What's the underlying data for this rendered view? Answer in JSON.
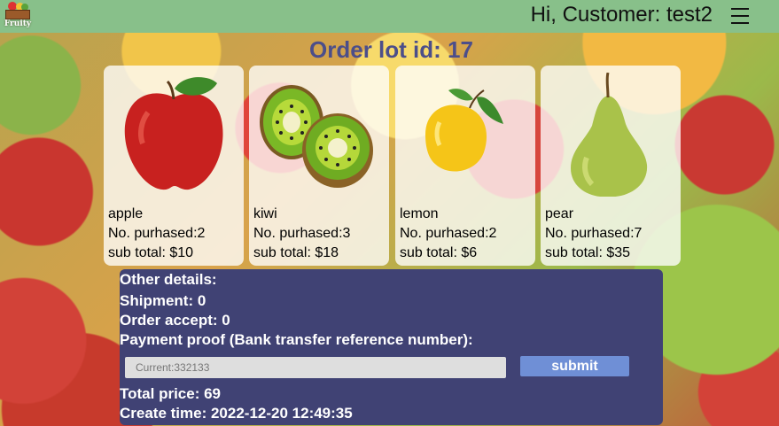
{
  "header": {
    "logo_text": "Fruity",
    "greeting": "Hi, Customer: test2"
  },
  "page_title": "Order lot id: 17",
  "items": [
    {
      "name": "apple",
      "qty_label": "No. purhased:2",
      "subtotal_label": "sub total: $10",
      "icon": "apple-icon"
    },
    {
      "name": "kiwi",
      "qty_label": "No. purhased:3",
      "subtotal_label": "sub total: $18",
      "icon": "kiwi-icon"
    },
    {
      "name": "lemon",
      "qty_label": "No. purhased:2",
      "subtotal_label": "sub total: $6",
      "icon": "lemon-icon"
    },
    {
      "name": "pear",
      "qty_label": "No. purhased:7",
      "subtotal_label": "sub total: $35",
      "icon": "pear-icon"
    }
  ],
  "details": {
    "heading": "Other details:",
    "shipment": "Shipment: 0",
    "order_accept": "Order accept: 0",
    "payment_proof_label": "Payment proof (Bank transfer reference number):",
    "payment_placeholder": "Current:332133",
    "submit_label": "submit",
    "total_price": "Total price: 69",
    "create_time": "Create time: 2022-12-20 12:49:35"
  },
  "colors": {
    "header_bg": "#88c08a",
    "title_color": "#4c4e8a",
    "details_bg": "#404274",
    "submit_bg": "#6f8fd6"
  }
}
